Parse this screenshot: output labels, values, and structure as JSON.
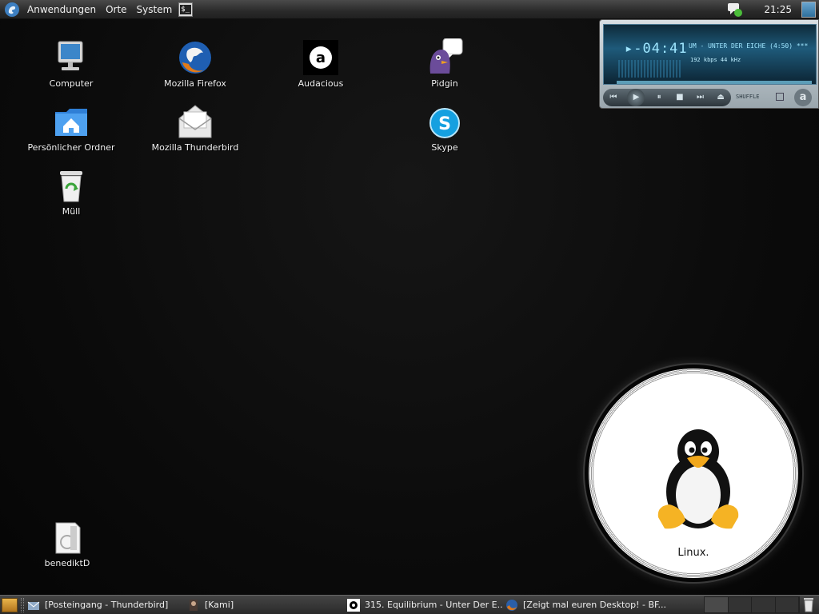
{
  "top_panel": {
    "menus": [
      "Anwendungen",
      "Orte",
      "System"
    ],
    "clock": "21:25"
  },
  "desktop_icons": {
    "computer": "Computer",
    "firefox": "Mozilla Firefox",
    "audacious": "Audacious",
    "pidgin": "Pidgin",
    "home": "Persönlicher Ordner",
    "thunderbird": "Mozilla Thunderbird",
    "skype": "Skype",
    "trash": "Müll",
    "volume": "benediktD"
  },
  "player": {
    "time": "▸-04:41",
    "title": "UM - UNTER DER EICHE (4:50) ***",
    "bitrate": "192 kbps  44 kHz",
    "shuffle": "SHUFFLE",
    "logo": "a"
  },
  "linux_badge": {
    "label": "Linux."
  },
  "taskbar": {
    "tasks": [
      "[Posteingang - Thunderbird]",
      "[Kami]",
      "315. Equilibrium - Unter Der E...",
      "[Zeigt mal euren Desktop! - BF..."
    ]
  },
  "colors": {
    "panel": "#2a2a2a",
    "desktop_bg": "#0b0b0b",
    "player_screen": "#1e5a7a",
    "player_text": "#9fe6ff"
  }
}
